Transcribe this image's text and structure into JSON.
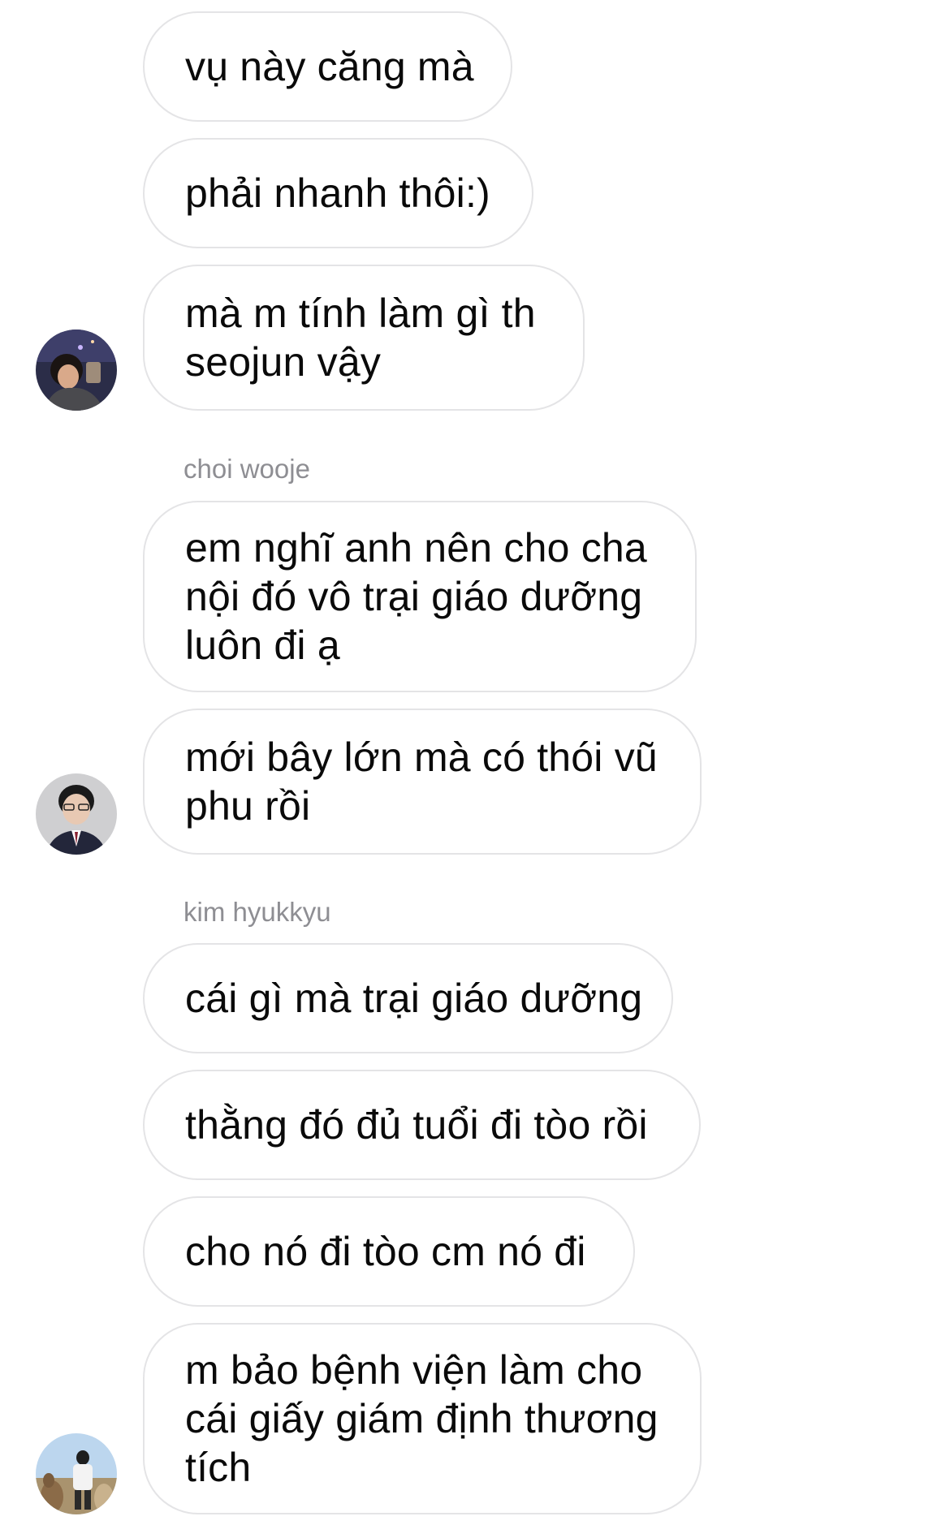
{
  "groups": [
    {
      "sender": "",
      "avatar": "user-photo-night",
      "messages": [
        "vụ này căng mà",
        "phải nhanh thôi:)",
        "mà m tính làm gì th\nseojun vậy"
      ]
    },
    {
      "sender": "choi wooje",
      "avatar": "user-photo-suit",
      "messages": [
        "em nghĩ anh nên cho cha\nnội đó vô trại giáo dưỡng\nluôn đi ạ",
        "mới bây lớn mà có thói vũ\nphu rồi"
      ]
    },
    {
      "sender": "kim hyukkyu",
      "avatar": "user-photo-alpaca",
      "messages": [
        "cái gì mà trại giáo dưỡng",
        "thằng đó đủ tuổi đi tòo rồi",
        "cho nó đi tòo cm nó đi",
        "m bảo bệnh viện làm cho\ncái giấy giám định thương\ntích"
      ]
    }
  ]
}
